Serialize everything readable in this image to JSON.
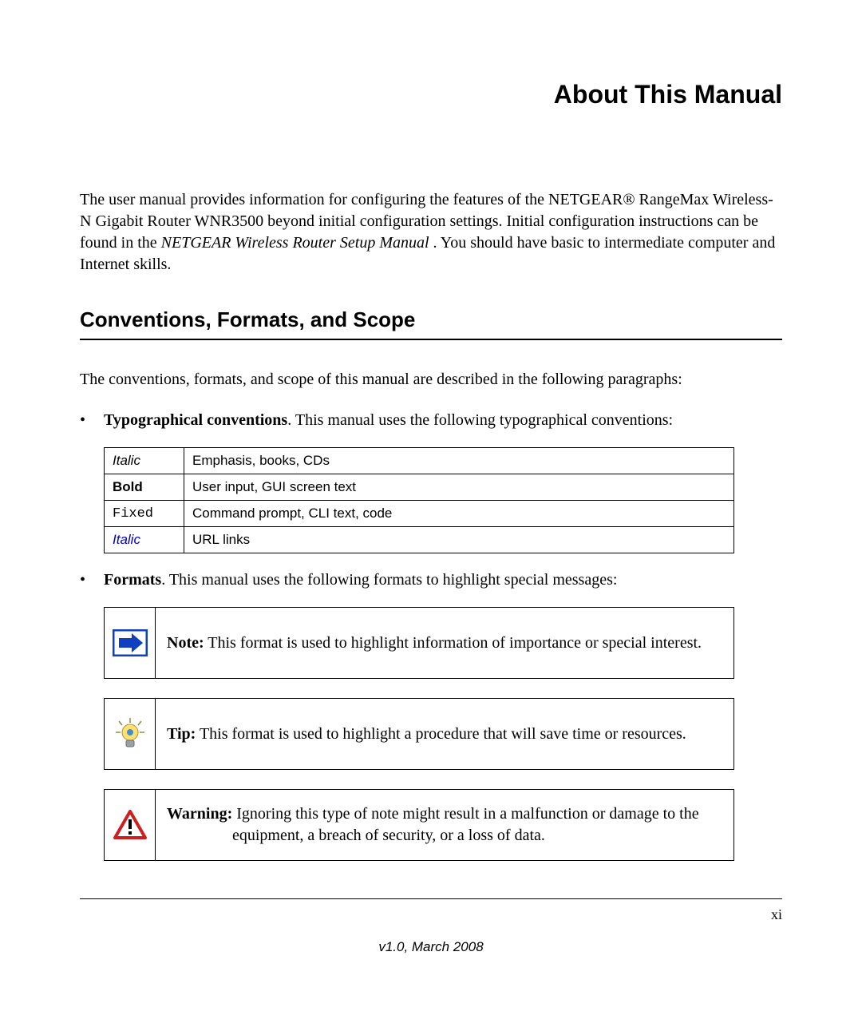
{
  "title": "About This Manual",
  "intro": {
    "before_ital": "The user manual provides information for configuring the features of the NETGEAR® RangeMax Wireless-N Gigabit Router WNR3500 beyond initial configuration settings. Initial configuration instructions can be found in the ",
    "ital": "NETGEAR Wireless Router Setup Manual",
    "after_ital": ". You should have basic to intermediate computer and Internet skills."
  },
  "section_heading": "Conventions, Formats, and Scope",
  "section_intro": "The conventions, formats, and scope of this manual are described in the following paragraphs:",
  "bullets": {
    "typographical": {
      "label": "Typographical conventions",
      "text": ". This manual uses the following typographical conventions:"
    },
    "formats": {
      "label": "Formats",
      "text": ". This manual uses the following formats to highlight special messages:"
    }
  },
  "conventions_table": [
    {
      "style_class": "style-italic",
      "style_text": "Italic",
      "desc": "Emphasis, books, CDs"
    },
    {
      "style_class": "style-bold",
      "style_text": "Bold",
      "desc": "User input, GUI screen text"
    },
    {
      "style_class": "style-fixed",
      "style_text": "Fixed",
      "desc": "Command prompt, CLI text, code"
    },
    {
      "style_class": "style-link",
      "style_text": "Italic",
      "desc": "URL links"
    }
  ],
  "callouts": {
    "note": {
      "label": "Note:",
      "text": " This format is used to highlight information of importance or special interest."
    },
    "tip": {
      "label": "Tip:",
      "text": " This format is used to highlight a procedure that will save time or resources."
    },
    "warning": {
      "label": "Warning:",
      "line1": " Ignoring this type of note might result in a malfunction or damage to the",
      "line2": "equipment, a breach of security, or a loss of data."
    }
  },
  "footer": {
    "page_number": "xi",
    "version": "v1.0, March 2008"
  }
}
